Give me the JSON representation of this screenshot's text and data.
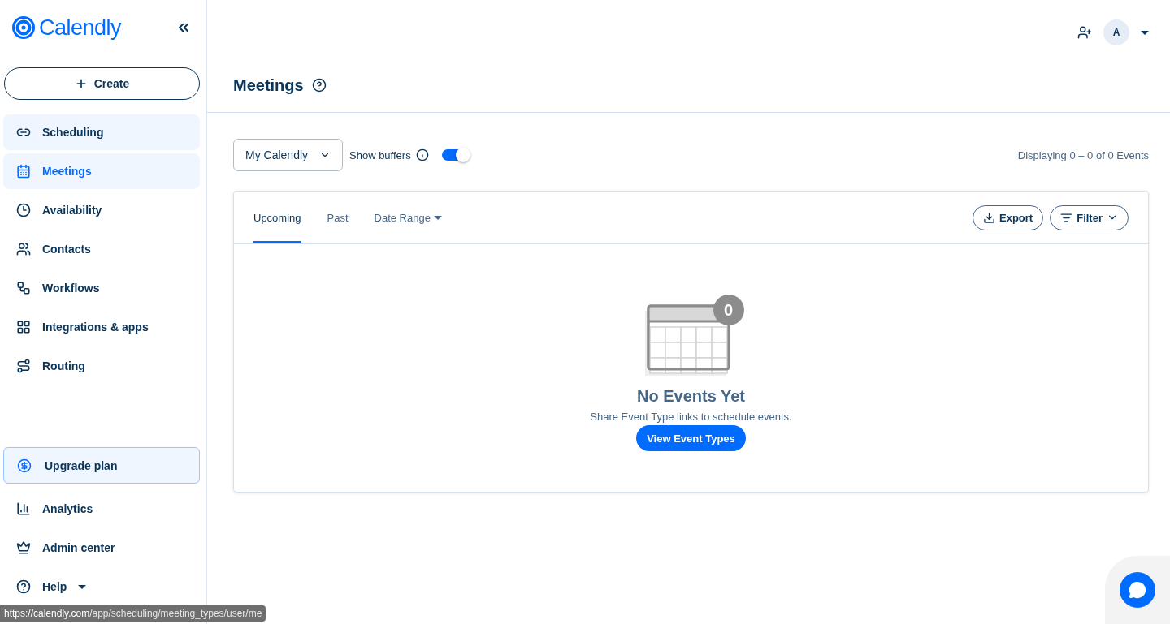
{
  "brand": {
    "name": "Calendly"
  },
  "sidebar": {
    "create_label": "Create",
    "items": [
      {
        "label": "Scheduling",
        "selected": false,
        "hovered": true
      },
      {
        "label": "Meetings",
        "selected": true,
        "hovered": false
      },
      {
        "label": "Availability",
        "selected": false,
        "hovered": false
      },
      {
        "label": "Contacts",
        "selected": false,
        "hovered": false
      },
      {
        "label": "Workflows",
        "selected": false,
        "hovered": false
      },
      {
        "label": "Integrations & apps",
        "selected": false,
        "hovered": false
      },
      {
        "label": "Routing",
        "selected": false,
        "hovered": false
      }
    ],
    "upgrade_label": "Upgrade plan",
    "bottom_items": [
      {
        "label": "Analytics",
        "dropdown": false
      },
      {
        "label": "Admin center",
        "dropdown": false
      },
      {
        "label": "Help",
        "dropdown": true
      }
    ]
  },
  "header": {
    "avatar_initial": "A"
  },
  "page": {
    "title": "Meetings",
    "calendar_select": "My Calendly",
    "show_buffers_label": "Show buffers",
    "show_buffers_on": true,
    "displaying": "Displaying 0 – 0 of 0 Events"
  },
  "tabs": [
    {
      "label": "Upcoming",
      "selected": true,
      "dropdown": false
    },
    {
      "label": "Past",
      "selected": false,
      "dropdown": false
    },
    {
      "label": "Date Range",
      "selected": false,
      "dropdown": true
    }
  ],
  "actions": {
    "export": "Export",
    "filter": "Filter"
  },
  "empty_state": {
    "count": "0",
    "title": "No Events Yet",
    "text": "Share Event Type links to schedule events.",
    "button": "View Event Types"
  },
  "status_bar": {
    "url": "**https://calendly.com**/app/scheduling/meeting_types/user/me"
  }
}
